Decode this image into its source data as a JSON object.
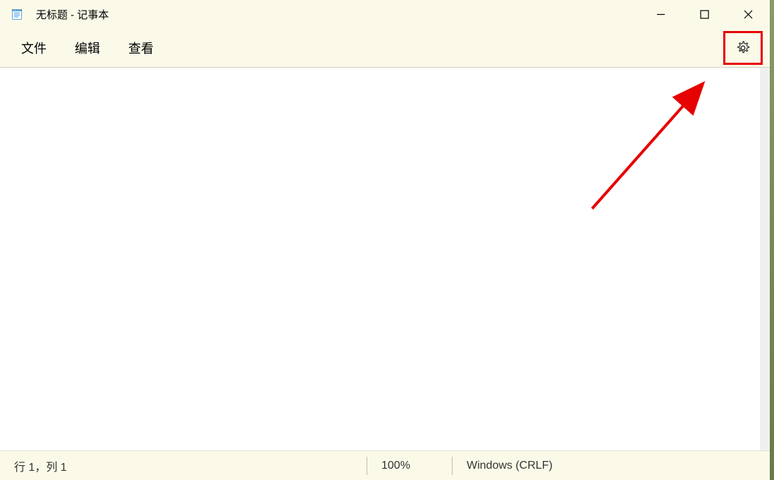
{
  "titlebar": {
    "title": "无标题 - 记事本"
  },
  "menubar": {
    "file": "文件",
    "edit": "编辑",
    "view": "查看"
  },
  "editor": {
    "content": ""
  },
  "statusbar": {
    "position": "行 1，列 1",
    "zoom": "100%",
    "encoding": "Windows (CRLF)"
  }
}
